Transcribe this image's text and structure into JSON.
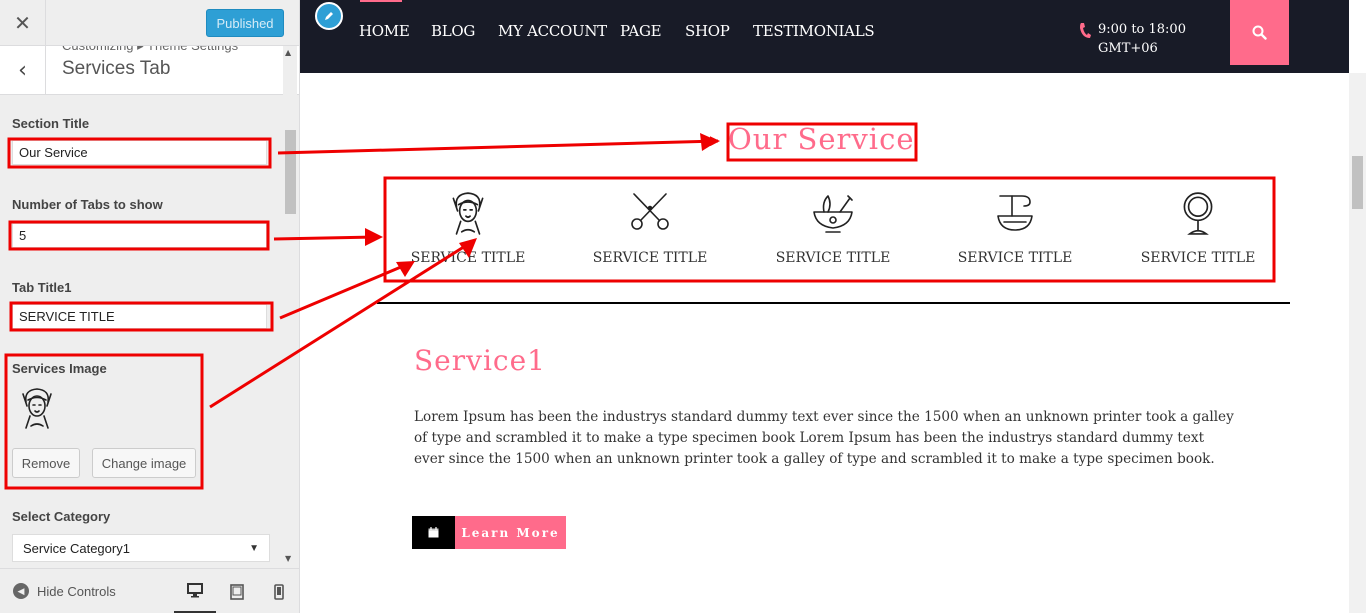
{
  "customizer": {
    "close_icon": "close-icon",
    "publish_label": "Published",
    "breadcrumb": "Customizing ▸ Theme Settings",
    "section_name": "Services Tab",
    "section_title_label": "Section Title",
    "section_title_value": "Our Service",
    "num_tabs_label": "Number of Tabs to show",
    "num_tabs_value": "5",
    "tab_title_label": "Tab Title1",
    "tab_title_value": "SERVICE TITLE",
    "services_image_label": "Services Image",
    "remove_label": "Remove",
    "change_image_label": "Change image",
    "category_label": "Select Category",
    "category_value": "Service Category1",
    "hide_controls_label": "Hide Controls"
  },
  "preview": {
    "nav": [
      "HOME",
      "BLOG",
      "MY ACCOUNT",
      "PAGE",
      "SHOP",
      "TESTIMONIALS"
    ],
    "phone_line1": "9:00 to 18:00",
    "phone_line2": "GMT+06",
    "section_heading": "Our Service",
    "services": [
      {
        "title": "SERVICE TITLE",
        "icon": "woman-face-icon"
      },
      {
        "title": "SERVICE TITLE",
        "icon": "scissors-icon"
      },
      {
        "title": "SERVICE TITLE",
        "icon": "herbal-bowl-icon"
      },
      {
        "title": "SERVICE TITLE",
        "icon": "cream-bowl-icon"
      },
      {
        "title": "SERVICE TITLE",
        "icon": "mirror-icon"
      }
    ],
    "active_service_heading": "Service1",
    "active_service_text": "Lorem Ipsum has been the industrys standard dummy text ever since the 1500 when an unknown printer took a galley of type and scrambled it to make a type specimen book Lorem Ipsum has been the industrys standard dummy text ever since the 1500 when an unknown printer took a galley of type and scrambled it to make a type specimen book.",
    "learn_more_label": "Learn More"
  },
  "colors": {
    "accent_pink": "#ff6b8b",
    "nav_dark": "#181b27",
    "annotation_red": "#ee0000",
    "wp_blue": "#2e9fd5"
  }
}
